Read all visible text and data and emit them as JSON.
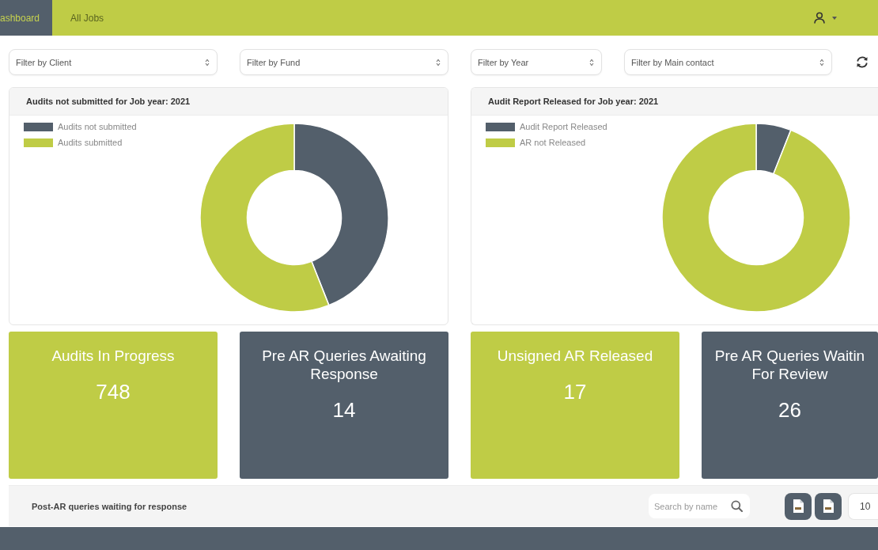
{
  "nav": {
    "tabs": [
      {
        "label": "ashboard",
        "selected": true
      },
      {
        "label": "All Jobs",
        "selected": false
      }
    ]
  },
  "filters": [
    {
      "label": "Filter by Client"
    },
    {
      "label": "Filter by Fund"
    },
    {
      "label": "Filter by Year"
    },
    {
      "label": "Filter by Main contact"
    }
  ],
  "chart_panels": [
    {
      "chart_data": {
        "type": "donut",
        "title": "Audits not submitted for Job year: 2021",
        "categories": [
          "Audits not submitted",
          "Audits submitted"
        ],
        "values": [
          44,
          56
        ],
        "colors": [
          "#535f6b",
          "#bfcc46"
        ],
        "legend": "top-left"
      }
    },
    {
      "chart_data": {
        "type": "donut",
        "title": "Audit Report Released for Job year: 2021",
        "categories": [
          "Audit Report Released",
          "AR not Released"
        ],
        "values": [
          6,
          94
        ],
        "colors": [
          "#535f6b",
          "#bfcc46"
        ],
        "legend": "top-left"
      }
    }
  ],
  "stat_cards": [
    {
      "title": "Audits In Progress",
      "value": "748",
      "color": "#bfcc46"
    },
    {
      "title": "Pre AR Queries Awaiting Response",
      "value": "14",
      "color": "#535f6b"
    },
    {
      "title": "Unsigned AR Released",
      "value": "17",
      "color": "#bfcc46"
    },
    {
      "title": "Pre AR Queries Waitin For Review",
      "value": "26",
      "color": "#535f6b"
    }
  ],
  "table_panel": {
    "title": "Post-AR queries waiting for response",
    "search": {
      "placeholder": "Search by name"
    },
    "page_size": "10"
  }
}
